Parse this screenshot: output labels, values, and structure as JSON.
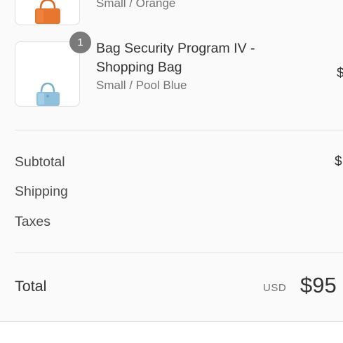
{
  "cart": {
    "items": [
      {
        "variant": "Small / Orange",
        "image_icon": "orange-handbag-icon",
        "image_color": "#e9762f"
      },
      {
        "quantity": "1",
        "title": "Bag Security Program IV - Shopping Bag",
        "variant": "Small / Pool Blue",
        "price_partial": "$",
        "image_icon": "blue-handbag-icon",
        "image_color": "#8fc1dd"
      }
    ]
  },
  "summary": {
    "subtotal_label": "Subtotal",
    "subtotal_value_partial": "$",
    "shipping_label": "Shipping",
    "taxes_label": "Taxes"
  },
  "total": {
    "label": "Total",
    "currency": "USD",
    "amount_partial": "$95"
  },
  "colors": {
    "panel_background": "#fafafa",
    "badge_background": "#7a7a7a",
    "divider": "#e1e1e1"
  }
}
